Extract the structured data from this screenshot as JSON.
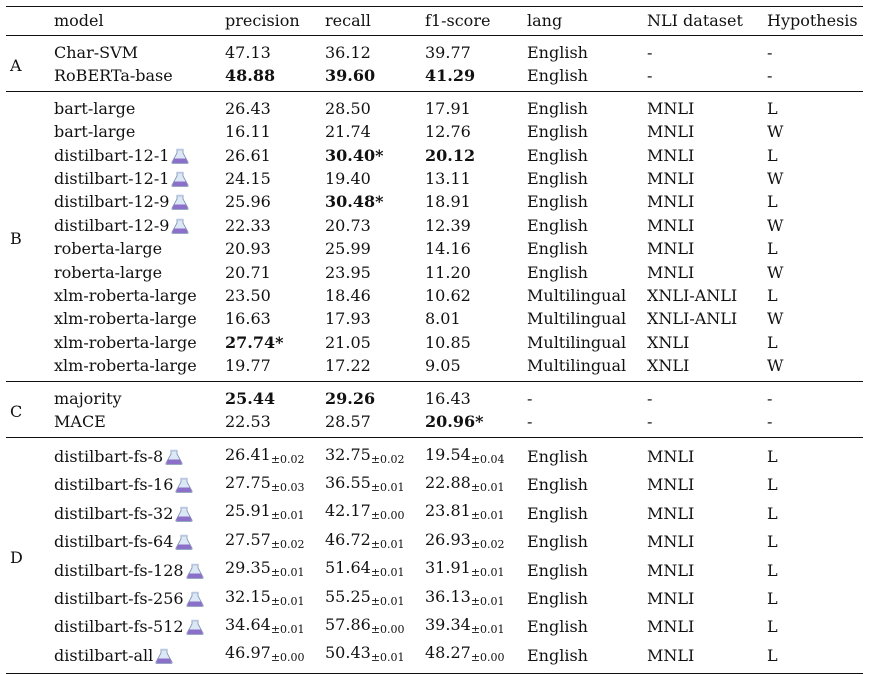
{
  "headers": [
    "model",
    "precision",
    "recall",
    "f1-score",
    "lang",
    "NLI dataset",
    "Hypothesis"
  ],
  "groups": [
    {
      "label": "A",
      "rows": [
        {
          "model": "Char-SVM",
          "precision": "47.13",
          "recall": "36.12",
          "f1": "39.77",
          "lang": "English",
          "nli": "-",
          "hyp": "-"
        },
        {
          "model": "RoBERTa-base",
          "precision": "48.88",
          "recall": "39.60",
          "f1": "41.29",
          "lang": "English",
          "nli": "-",
          "hyp": "-",
          "bold": [
            "precision",
            "recall",
            "f1"
          ]
        }
      ]
    },
    {
      "label": "B",
      "rows": [
        {
          "model": "bart-large",
          "precision": "26.43",
          "recall": "28.50",
          "f1": "17.91",
          "lang": "English",
          "nli": "MNLI",
          "hyp": "L"
        },
        {
          "model": "bart-large",
          "precision": "16.11",
          "recall": "21.74",
          "f1": "12.76",
          "lang": "English",
          "nli": "MNLI",
          "hyp": "W"
        },
        {
          "model": "distilbart-12-1",
          "icon": "flask-icon",
          "precision": "26.61",
          "recall": "30.40*",
          "f1": "20.12",
          "lang": "English",
          "nli": "MNLI",
          "hyp": "L",
          "bold": [
            "recall",
            "f1"
          ]
        },
        {
          "model": "distilbart-12-1",
          "icon": "flask-icon",
          "precision": "24.15",
          "recall": "19.40",
          "f1": "13.11",
          "lang": "English",
          "nli": "MNLI",
          "hyp": "W"
        },
        {
          "model": "distilbart-12-9",
          "icon": "flask-icon",
          "precision": "25.96",
          "recall": "30.48*",
          "f1": "18.91",
          "lang": "English",
          "nli": "MNLI",
          "hyp": "L",
          "bold": [
            "recall"
          ]
        },
        {
          "model": "distilbart-12-9",
          "icon": "flask-icon",
          "precision": "22.33",
          "recall": "20.73",
          "f1": "12.39",
          "lang": "English",
          "nli": "MNLI",
          "hyp": "W"
        },
        {
          "model": "roberta-large",
          "precision": "20.93",
          "recall": "25.99",
          "f1": "14.16",
          "lang": "English",
          "nli": "MNLI",
          "hyp": "L"
        },
        {
          "model": "roberta-large",
          "precision": "20.71",
          "recall": "23.95",
          "f1": "11.20",
          "lang": "English",
          "nli": "MNLI",
          "hyp": "W"
        },
        {
          "model": "xlm-roberta-large",
          "precision": "23.50",
          "recall": "18.46",
          "f1": "10.62",
          "lang": "Multilingual",
          "nli": "XNLI-ANLI",
          "hyp": "L"
        },
        {
          "model": "xlm-roberta-large",
          "precision": "16.63",
          "recall": "17.93",
          "f1": "8.01",
          "lang": "Multilingual",
          "nli": "XNLI-ANLI",
          "hyp": "W"
        },
        {
          "model": "xlm-roberta-large",
          "precision": "27.74*",
          "recall": "21.05",
          "f1": "10.85",
          "lang": "Multilingual",
          "nli": "XNLI",
          "hyp": "L",
          "bold": [
            "precision"
          ]
        },
        {
          "model": "xlm-roberta-large",
          "precision": "19.77",
          "recall": "17.22",
          "f1": "9.05",
          "lang": "Multilingual",
          "nli": "XNLI",
          "hyp": "W"
        }
      ]
    },
    {
      "label": "C",
      "rows": [
        {
          "model": "majority",
          "precision": "25.44",
          "recall": "29.26",
          "f1": "16.43",
          "lang": "-",
          "nli": "-",
          "hyp": "-",
          "bold": [
            "precision",
            "recall"
          ]
        },
        {
          "model": "MACE",
          "precision": "22.53",
          "recall": "28.57",
          "f1": "20.96*",
          "lang": "-",
          "nli": "-",
          "hyp": "-",
          "bold": [
            "f1"
          ]
        }
      ]
    },
    {
      "label": "D",
      "rows": [
        {
          "model": "distilbart-fs-8",
          "icon": "flask-icon",
          "precision": "26.41",
          "precision_sd": "±0.02",
          "recall": "32.75",
          "recall_sd": "±0.02",
          "f1": "19.54",
          "f1_sd": "±0.04",
          "lang": "English",
          "nli": "MNLI",
          "hyp": "L"
        },
        {
          "model": "distilbart-fs-16",
          "icon": "flask-icon",
          "precision": "27.75",
          "precision_sd": "±0.03",
          "recall": "36.55",
          "recall_sd": "±0.01",
          "f1": "22.88",
          "f1_sd": "±0.01",
          "lang": "English",
          "nli": "MNLI",
          "hyp": "L"
        },
        {
          "model": "distilbart-fs-32",
          "icon": "flask-icon",
          "precision": "25.91",
          "precision_sd": "±0.01",
          "recall": "42.17",
          "recall_sd": "±0.00",
          "f1": "23.81",
          "f1_sd": "±0.01",
          "lang": "English",
          "nli": "MNLI",
          "hyp": "L"
        },
        {
          "model": "distilbart-fs-64",
          "icon": "flask-icon",
          "precision": "27.57",
          "precision_sd": "±0.02",
          "recall": "46.72",
          "recall_sd": "±0.01",
          "f1": "26.93",
          "f1_sd": "±0.02",
          "lang": "English",
          "nli": "MNLI",
          "hyp": "L"
        },
        {
          "model": "distilbart-fs-128",
          "icon": "flask-icon",
          "precision": "29.35",
          "precision_sd": "±0.01",
          "recall": "51.64",
          "recall_sd": "±0.01",
          "f1": "31.91",
          "f1_sd": "±0.01",
          "lang": "English",
          "nli": "MNLI",
          "hyp": "L"
        },
        {
          "model": "distilbart-fs-256",
          "icon": "flask-icon",
          "precision": "32.15",
          "precision_sd": "±0.01",
          "recall": "55.25",
          "recall_sd": "±0.01",
          "f1": "36.13",
          "f1_sd": "±0.01",
          "lang": "English",
          "nli": "MNLI",
          "hyp": "L"
        },
        {
          "model": "distilbart-fs-512",
          "icon": "flask-icon",
          "precision": "34.64",
          "precision_sd": "±0.01",
          "recall": "57.86",
          "recall_sd": "±0.00",
          "f1": "39.34",
          "f1_sd": "±0.01",
          "lang": "English",
          "nli": "MNLI",
          "hyp": "L"
        },
        {
          "model": "distilbart-all",
          "icon": "flask-icon",
          "precision": "46.97",
          "precision_sd": "±0.00",
          "recall": "50.43",
          "recall_sd": "±0.01",
          "f1": "48.27",
          "f1_sd": "±0.00",
          "lang": "English",
          "nli": "MNLI",
          "hyp": "L"
        }
      ]
    }
  ]
}
